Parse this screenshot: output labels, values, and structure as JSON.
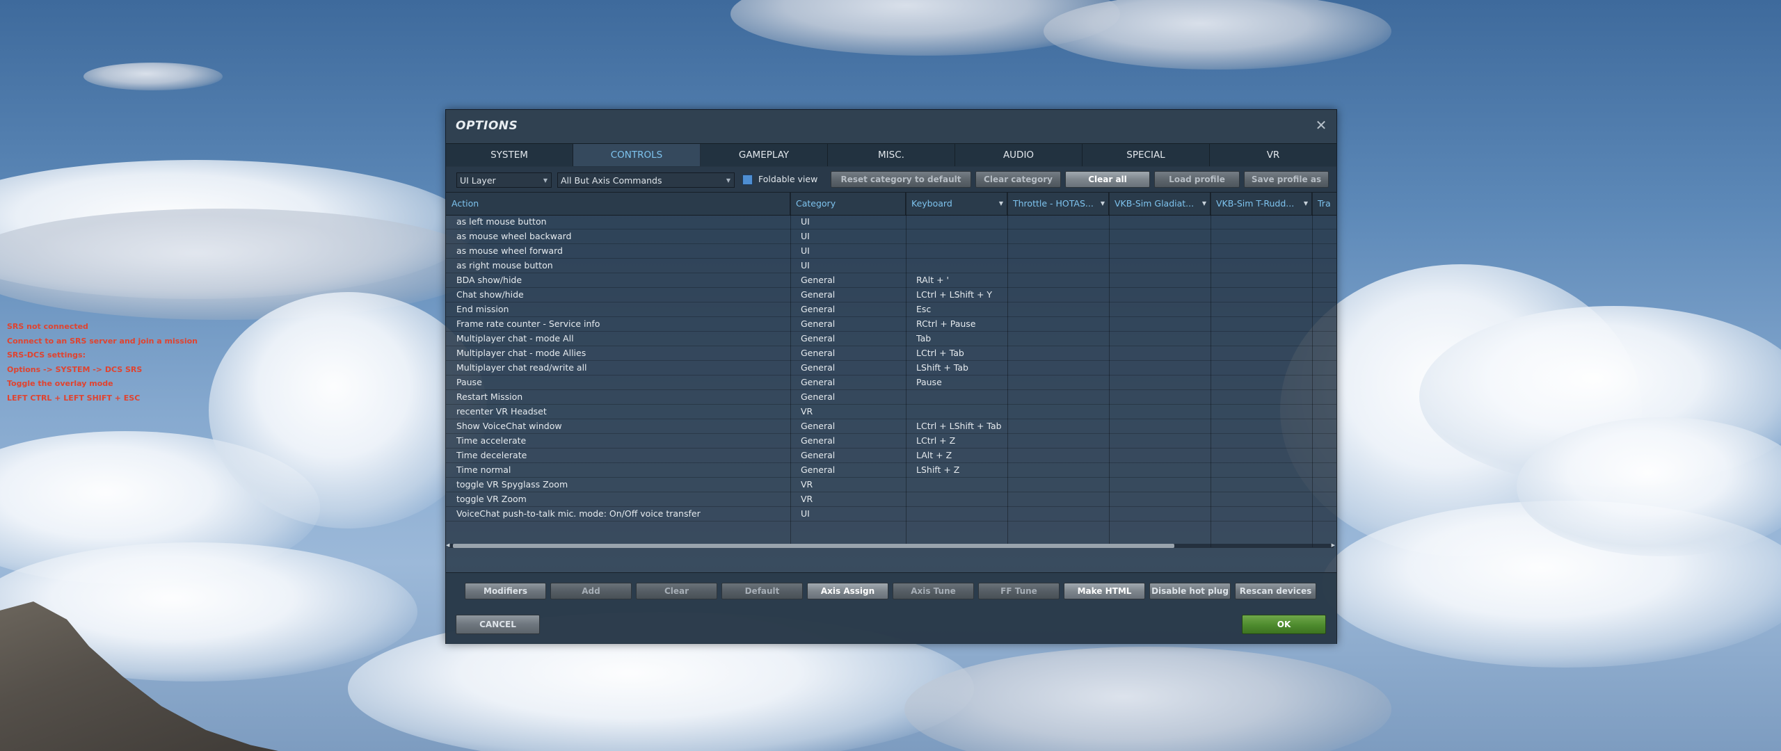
{
  "overlay": {
    "lines": [
      "SRS not connected",
      "Connect to an SRS server and join a mission",
      "SRS-DCS settings:",
      "Options -> SYSTEM -> DCS SRS",
      "Toggle the overlay mode",
      "LEFT CTRL + LEFT SHIFT + ESC"
    ],
    "color": "#e0432f"
  },
  "window": {
    "title": "OPTIONS",
    "close_icon": "close-icon"
  },
  "tabs": [
    {
      "label": "SYSTEM",
      "active": false
    },
    {
      "label": "CONTROLS",
      "active": true
    },
    {
      "label": "GAMEPLAY",
      "active": false
    },
    {
      "label": "MISC.",
      "active": false
    },
    {
      "label": "AUDIO",
      "active": false
    },
    {
      "label": "SPECIAL",
      "active": false
    },
    {
      "label": "VR",
      "active": false
    }
  ],
  "filters": {
    "layer": "UI Layer",
    "commands": "All But Axis Commands",
    "foldable_checked": true,
    "foldable_label": "Foldable view"
  },
  "toolbar": {
    "reset_category": "Reset category to default",
    "clear_category": "Clear category",
    "clear_all": "Clear all",
    "load_profile": "Load profile",
    "save_profile_as": "Save profile as"
  },
  "table": {
    "headers": [
      "Action",
      "Category",
      "Keyboard",
      "Throttle - HOTAS...",
      "VKB-Sim Gladiat...",
      "VKB-Sim T-Rudd...",
      "Tra"
    ],
    "rows": [
      {
        "action": "as left mouse button",
        "category": "UI",
        "keyboard": ""
      },
      {
        "action": "as mouse wheel backward",
        "category": "UI",
        "keyboard": ""
      },
      {
        "action": "as mouse wheel forward",
        "category": "UI",
        "keyboard": ""
      },
      {
        "action": "as right mouse button",
        "category": "UI",
        "keyboard": ""
      },
      {
        "action": "BDA show/hide",
        "category": "General",
        "keyboard": "RAlt + '"
      },
      {
        "action": "Chat show/hide",
        "category": "General",
        "keyboard": "LCtrl + LShift + Y"
      },
      {
        "action": "End mission",
        "category": "General",
        "keyboard": "Esc"
      },
      {
        "action": "Frame rate counter - Service info",
        "category": "General",
        "keyboard": "RCtrl + Pause"
      },
      {
        "action": "Multiplayer chat - mode All",
        "category": "General",
        "keyboard": "Tab"
      },
      {
        "action": "Multiplayer chat - mode Allies",
        "category": "General",
        "keyboard": "LCtrl + Tab"
      },
      {
        "action": "Multiplayer chat read/write all",
        "category": "General",
        "keyboard": "LShift + Tab"
      },
      {
        "action": "Pause",
        "category": "General",
        "keyboard": "Pause"
      },
      {
        "action": "Restart Mission",
        "category": "General",
        "keyboard": ""
      },
      {
        "action": "recenter VR Headset",
        "category": "VR",
        "keyboard": ""
      },
      {
        "action": "Show VoiceChat window",
        "category": "General",
        "keyboard": "LCtrl + LShift + Tab"
      },
      {
        "action": "Time accelerate",
        "category": "General",
        "keyboard": "LCtrl + Z"
      },
      {
        "action": "Time decelerate",
        "category": "General",
        "keyboard": "LAlt + Z"
      },
      {
        "action": "Time normal",
        "category": "General",
        "keyboard": "LShift + Z"
      },
      {
        "action": "toggle VR Spyglass Zoom",
        "category": "VR",
        "keyboard": ""
      },
      {
        "action": "toggle VR Zoom",
        "category": "VR",
        "keyboard": ""
      },
      {
        "action": "VoiceChat push-to-talk mic. mode: On/Off voice transfer",
        "category": "UI",
        "keyboard": ""
      }
    ]
  },
  "actions": {
    "modifiers": "Modifiers",
    "add": "Add",
    "clear": "Clear",
    "default": "Default",
    "axis_assign": "Axis Assign",
    "axis_tune": "Axis Tune",
    "ff_tune": "FF Tune",
    "make_html": "Make HTML",
    "disable_hot_plug": "Disable hot plug",
    "rescan_devices": "Rescan devices"
  },
  "footer": {
    "cancel": "CANCEL",
    "ok": "OK"
  },
  "colors": {
    "accent": "#7ec3ee",
    "ok_green": "#4d8a2d",
    "checkbox_blue": "#4e8ed2"
  }
}
